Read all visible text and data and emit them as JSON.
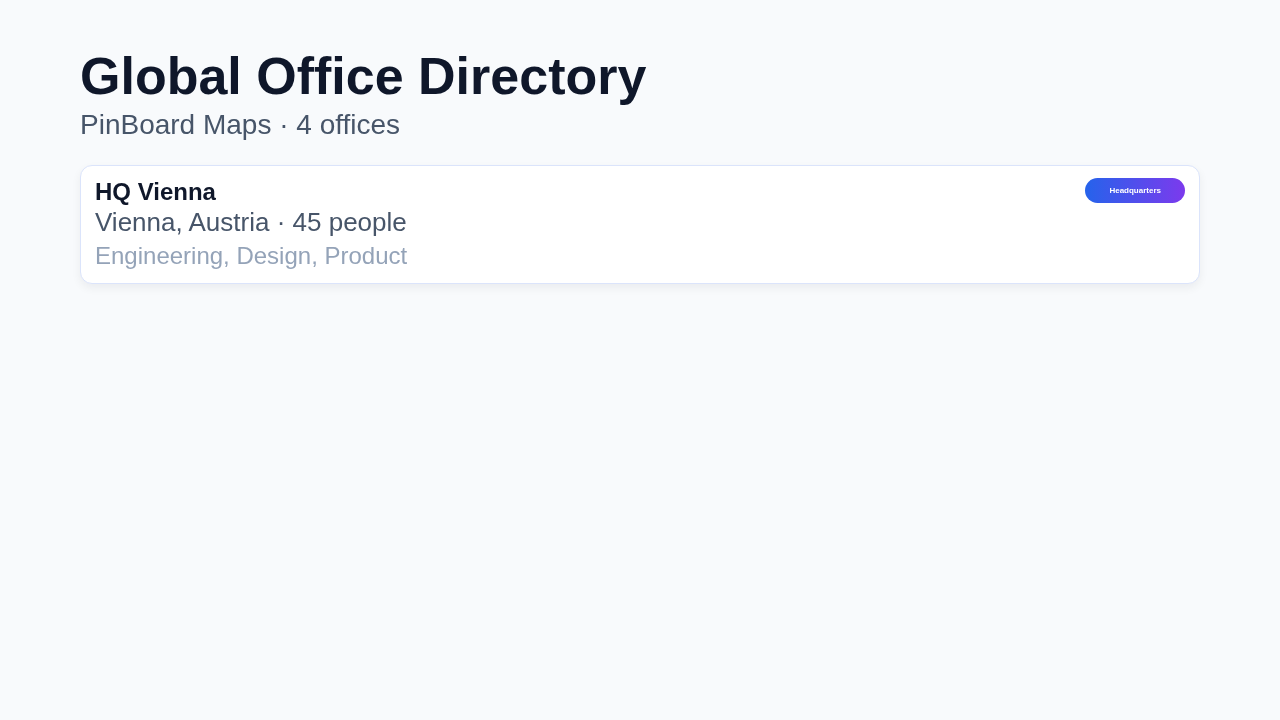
{
  "title": "Global Office Directory",
  "subtitle": "PinBoard Maps · 4 offices",
  "offices": [
    {
      "name": "HQ Vienna",
      "location": "Vienna, Austria · 45 people",
      "teams": "Engineering, Design, Product",
      "badge": {
        "kind": "headquarters",
        "label": "Headquarters"
      }
    }
  ]
}
